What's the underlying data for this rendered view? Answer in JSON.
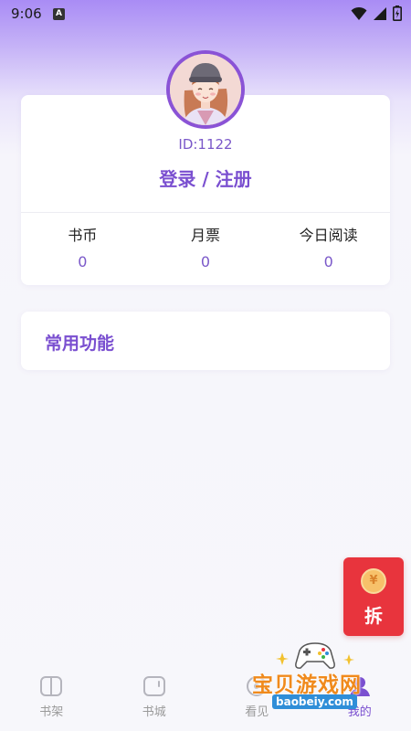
{
  "status_bar": {
    "time": "9:06",
    "notification_letter": "A"
  },
  "profile": {
    "user_id": "ID:1122",
    "login_label": "登录 / 注册",
    "stats": [
      {
        "label": "书币",
        "value": "0"
      },
      {
        "label": "月票",
        "value": "0"
      },
      {
        "label": "今日阅读",
        "value": "0"
      }
    ]
  },
  "functions": {
    "title": "常用功能"
  },
  "red_envelope": {
    "coin_symbol": "¥",
    "label": "拆"
  },
  "bottom_nav": {
    "items": [
      {
        "label": "书架",
        "icon": "bookshelf-icon",
        "active": false
      },
      {
        "label": "书城",
        "icon": "bookstore-icon",
        "active": false
      },
      {
        "label": "看见",
        "icon": "discover-icon",
        "active": false
      },
      {
        "label": "我的",
        "icon": "profile-icon",
        "active": true
      }
    ]
  },
  "watermark": {
    "text": "宝贝游戏网",
    "url": "baobeiy.com"
  },
  "colors": {
    "accent": "#7a4fd0",
    "red_envelope": "#e8343d",
    "header_gradient_top": "#a98cf5"
  }
}
